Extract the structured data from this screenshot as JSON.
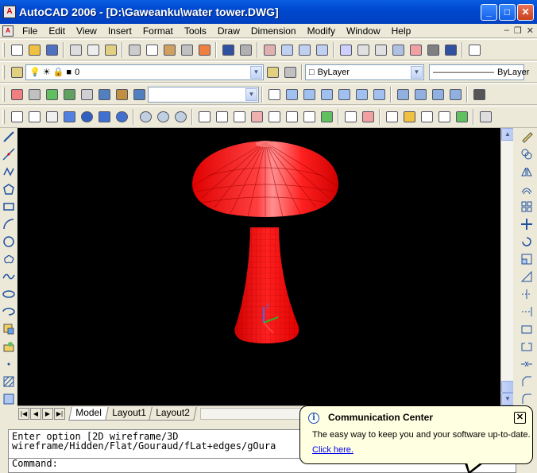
{
  "window": {
    "title": "AutoCAD 2006 - [D:\\Gaweanku\\water tower.DWG]",
    "app_icon_glyph": "A",
    "minimize_glyph": "_",
    "maximize_glyph": "□",
    "close_glyph": "✕"
  },
  "menu": {
    "items": [
      "File",
      "Edit",
      "View",
      "Insert",
      "Format",
      "Tools",
      "Draw",
      "Dimension",
      "Modify",
      "Window",
      "Help"
    ],
    "doc_controls": [
      "–",
      "❐",
      "✕"
    ]
  },
  "layers_toolbar": {
    "layer_value": "0",
    "color_value": "ByLayer",
    "linetype_value": "ByLayer"
  },
  "view_toolbar": {
    "named_view_value": ""
  },
  "tabs": {
    "nav": [
      "|◀",
      "◀",
      "▶",
      "▶|"
    ],
    "items": [
      "Model",
      "Layout1",
      "Layout2"
    ],
    "active": "Model"
  },
  "command": {
    "line1": "Enter option [2D wireframe/3D",
    "line2": "wireframe/Hidden/Flat/Gouraud/fLat+edges/gOura",
    "prompt": "Command:"
  },
  "balloon": {
    "title": "Communication Center",
    "message": "The easy way to keep you and your software up-to-date.",
    "link": "Click here.",
    "close_glyph": "✕",
    "info_glyph": "i"
  },
  "colors": {
    "viewport_bg": "#000000",
    "model_fill": "#ff0000",
    "model_light": "#ff6060",
    "model_dark": "#b00000",
    "titlebar": "#0048d0"
  },
  "icons": {
    "left_toolbar": [
      "line-icon",
      "construction-line-icon",
      "polyline-icon",
      "polygon-icon",
      "rectangle-icon",
      "arc-icon",
      "circle-icon",
      "revision-cloud-icon",
      "spline-icon",
      "ellipse-icon",
      "ellipse-arc-icon",
      "insert-block-icon",
      "make-block-icon",
      "point-icon",
      "hatch-icon",
      "region-icon"
    ],
    "right_toolbar": [
      "erase-icon",
      "copy-icon",
      "mirror-icon",
      "offset-icon",
      "array-icon",
      "move-icon",
      "rotate-icon",
      "scale-icon",
      "stretch-icon",
      "trim-icon",
      "extend-icon",
      "break-at-point-icon",
      "break-icon",
      "join-icon",
      "chamfer-icon",
      "fillet-icon"
    ]
  }
}
